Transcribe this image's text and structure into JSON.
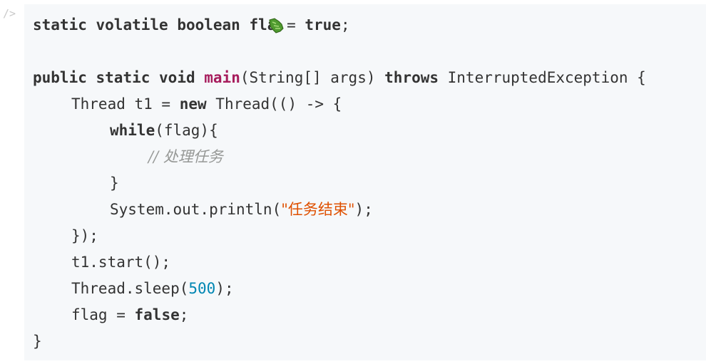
{
  "gutter": {
    "marker": "/>"
  },
  "code": {
    "line1": {
      "kw1": "static",
      "kw2": "volatile",
      "kw3": "boolean",
      "name_part": "fla",
      "after_cursor": " = ",
      "kw_true": "true",
      "end": ";"
    },
    "line2": {
      "kw1": "public",
      "kw2": "static",
      "kw3": "void",
      "method": "main",
      "params": "(String[] args) ",
      "kw_throws": "throws",
      "exc": " InterruptedException {"
    },
    "line3": {
      "text1": "Thread t1 = ",
      "kw_new": "new",
      "text2": " Thread(() -> {"
    },
    "line4": {
      "kw_while": "while",
      "text": "(flag){"
    },
    "line5": {
      "comment": "// 处理任务"
    },
    "line6": {
      "text": "}"
    },
    "line7": {
      "text1": "System.out.println(",
      "string": "\"任务结束\"",
      "text2": ");"
    },
    "line8": {
      "text": "});"
    },
    "line9": {
      "text": "t1.start();"
    },
    "line10": {
      "text1": "Thread.sleep(",
      "number": "500",
      "text2": ");"
    },
    "line11": {
      "text1": "flag = ",
      "kw_false": "false",
      "text2": ";"
    },
    "line12": {
      "text": "}"
    }
  },
  "icons": {
    "cursor": "pointer-cursor-icon",
    "cursor_color": "#4f9a2f"
  }
}
